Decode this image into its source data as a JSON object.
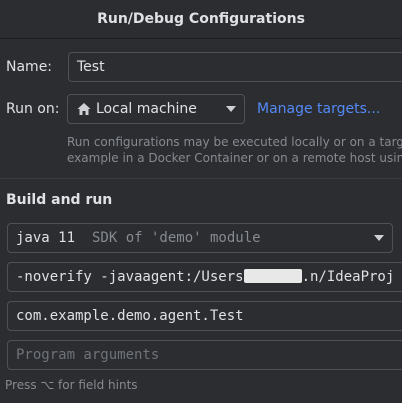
{
  "dialog": {
    "title": "Run/Debug Configurations"
  },
  "form": {
    "name_label": "Name:",
    "name_value": "Test",
    "run_on_label": "Run on:",
    "run_on_value": "Local machine",
    "manage_targets_link": "Manage targets...",
    "run_on_hint_line1": "Run configurations may be executed locally or on a target: fo",
    "run_on_hint_line2": "example in a Docker Container or on a remote host using SSH"
  },
  "build_and_run": {
    "section_title": "Build and run",
    "sdk_name": "java 11",
    "sdk_detail": "SDK of 'demo' module",
    "vm_options_prefix": "-noverify -javaagent:/Users",
    "vm_options_suffix": ".n/IdeaProj",
    "main_class": "com.example.demo.agent.Test",
    "program_args_placeholder": "Program arguments",
    "field_hint": "Press ⌥ for field hints"
  },
  "icons": {
    "run_on_icon": "home-icon",
    "dropdown_icon": "chevron-down-icon"
  },
  "colors": {
    "background": "#2b2d30",
    "link": "#548af7",
    "field_border": "#4e5157"
  }
}
